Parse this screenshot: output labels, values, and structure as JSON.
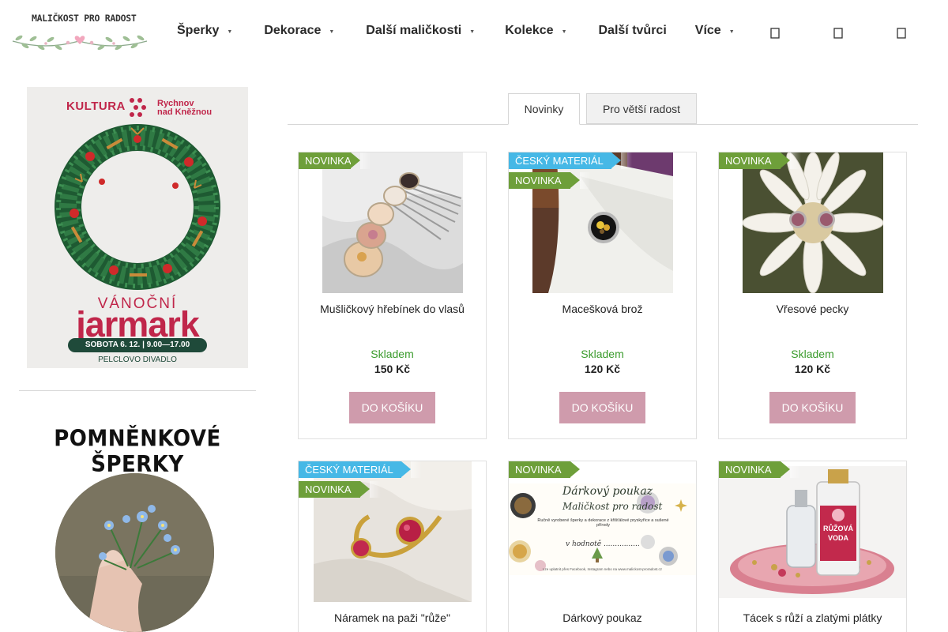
{
  "header": {
    "logo_text": "MALIČKOST PRO RADOST",
    "nav": [
      {
        "label": "Šperky",
        "has_caret": true
      },
      {
        "label": "Dekorace",
        "has_caret": true
      },
      {
        "label": "Další maličkosti",
        "has_caret": true
      },
      {
        "label": "Kolekce",
        "has_caret": true
      },
      {
        "label": "Další tvůrci",
        "has_caret": false
      },
      {
        "label": "Více",
        "has_caret": true
      }
    ],
    "caret_glyph": "▼",
    "icons": [
      "search-icon",
      "user-icon",
      "cart-icon"
    ]
  },
  "sidebar": {
    "poster": {
      "kultura": "KULTURA",
      "town_line1": "Rychnov",
      "town_line2": "nad Kněžnou",
      "title_small": "VÁNOČNÍ",
      "title_big": "jarmark",
      "date": "SOBOTA 6. 12. | 9.00—17.00",
      "place": "PELCLOVO DIVADLO"
    },
    "heading": "POMNĚNKOVÉ ŠPERKY"
  },
  "tabs": [
    {
      "label": "Novinky",
      "active": true
    },
    {
      "label": "Pro větší radost",
      "active": false
    }
  ],
  "products": [
    {
      "title": "Mušličkový hřebínek do vlasů",
      "stock": "Skladem",
      "price": "150 Kč",
      "button": "DO KOŠÍKU",
      "badges": [
        "NOVINKA"
      ]
    },
    {
      "title": "Macešková brož",
      "stock": "Skladem",
      "price": "120 Kč",
      "button": "DO KOŠÍKU",
      "badges": [
        "ČESKÝ MATERIÁL",
        "NOVINKA"
      ]
    },
    {
      "title": "Vřesové pecky",
      "stock": "Skladem",
      "price": "120 Kč",
      "button": "DO KOŠÍKU",
      "badges": [
        "NOVINKA"
      ]
    },
    {
      "title": "Náramek na paži \"růže\"",
      "badges": [
        "ČESKÝ MATERIÁL",
        "NOVINKA"
      ]
    },
    {
      "title": "Dárkový poukaz",
      "badges": [
        "NOVINKA"
      ],
      "voucher": {
        "line1": "Dárkový poukaz",
        "line2": "Maličkost pro radost",
        "line3": "Ručně vyrobené šperky a dekorace z křišťálové pryskyřice a sušené přírody",
        "line4": "v hodnotě ................",
        "line5": "Lze uplatnit přes Facebook, Instagram nebo na www.malickost-proradost.cz"
      }
    },
    {
      "title": "Tácek s růží a zlatými plátky",
      "badges": [
        "NOVINKA"
      ],
      "bottle_label_1": "RŮŽOVÁ",
      "bottle_label_2": "VODA"
    }
  ],
  "colors": {
    "badge_new": "#6e9f3a",
    "badge_czech": "#46b8e6",
    "stock": "#3a9b2c",
    "button": "#cf9bac",
    "poster_red": "#c0264a",
    "poster_green": "#1f4a3a"
  }
}
